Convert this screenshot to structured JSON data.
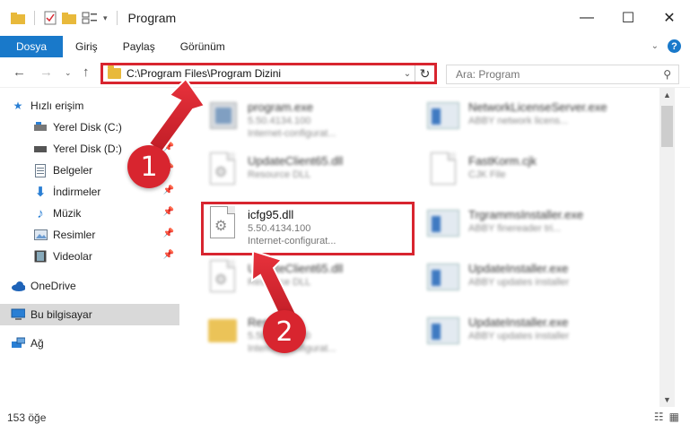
{
  "window": {
    "title": "Program"
  },
  "ribbon": {
    "tabs": [
      "Dosya",
      "Giriş",
      "Paylaş",
      "Görünüm"
    ]
  },
  "address": {
    "path": "C:\\Program Files\\Program Dizini"
  },
  "search": {
    "placeholder": "Ara: Program"
  },
  "sidebar": {
    "quick_access": "Hızlı erişim",
    "items": [
      "Yerel Disk (C:)",
      "Yerel Disk (D:)",
      "Belgeler",
      "İndirmeler",
      "Müzik",
      "Resimler",
      "Videolar"
    ],
    "onedrive": "OneDrive",
    "this_pc": "Bu bilgisayar",
    "network": "Ağ"
  },
  "files": [
    {
      "name": "program.exe",
      "line1": "5.50.4134.100",
      "line2": "Internet-configurat..."
    },
    {
      "name": "UpdateClient65.dll",
      "line1": "Resource DLL",
      "line2": ""
    },
    {
      "name": "icfg95.dll",
      "line1": "5.50.4134.100",
      "line2": "Internet-configurat..."
    },
    {
      "name": "UpdateClient65.dll",
      "line1": "Resource DLL",
      "line2": ""
    },
    {
      "name": "Resource",
      "line1": "5.50.4134.100",
      "line2": "Internet-configurat..."
    },
    {
      "name": "NetworkLicenseServer.exe",
      "line1": "ABBY network licens...",
      "line2": ""
    },
    {
      "name": "FastKorm.cjk",
      "line1": "CJK File",
      "line2": ""
    },
    {
      "name": "TrgrammsInstaller.exe",
      "line1": "ABBY finereader tri...",
      "line2": ""
    },
    {
      "name": "UpdateInstaller.exe",
      "line1": "ABBY updates installer",
      "line2": ""
    },
    {
      "name": "UpdateInstaller.exe",
      "line1": "ABBY updates installer",
      "line2": ""
    }
  ],
  "status": {
    "count": "153 öğe"
  },
  "callouts": [
    "1",
    "2"
  ]
}
